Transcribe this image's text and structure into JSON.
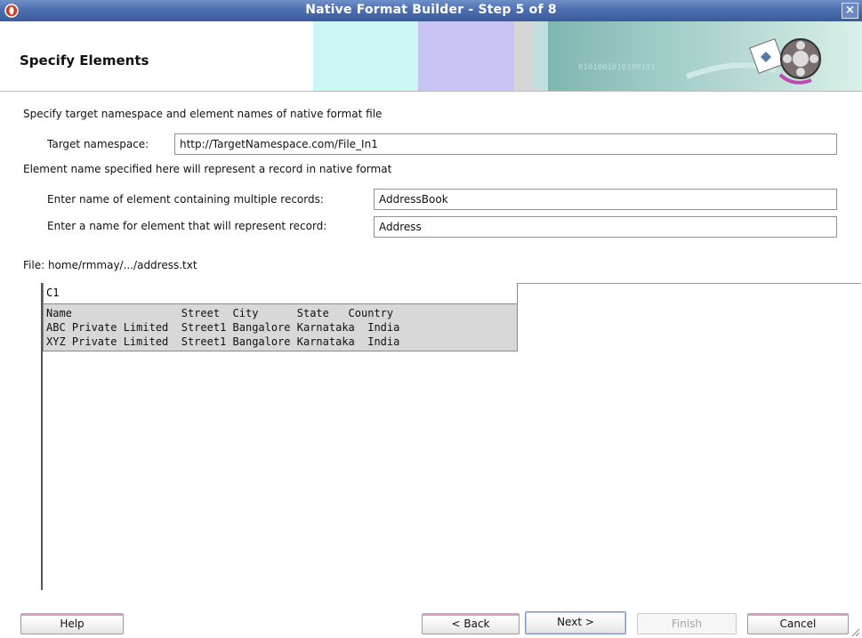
{
  "window": {
    "title": "Native Format Builder - Step 5 of 8",
    "close_label": "×"
  },
  "header": {
    "title": "Specify Elements"
  },
  "instructions": {
    "intro": "Specify target namespace and element names of native format file",
    "element_note": "Element name specified here will represent a record in native format"
  },
  "form": {
    "namespace_label": "Target namespace:",
    "namespace_value": "http://TargetNamespace.com/File_In1",
    "container_label": "Enter name of element containing multiple records:",
    "container_value": "AddressBook",
    "record_label": "Enter a name for element that will represent record:",
    "record_value": "Address"
  },
  "file": {
    "path_text": "File: home/rmmay/.../address.txt"
  },
  "preview": {
    "column_header": "C1",
    "rows": [
      "Name                 Street  City      State   Country",
      "ABC Private Limited  Street1 Bangalore Karnataka  India",
      "XYZ Private Limited  Street1 Bangalore Karnataka  India"
    ]
  },
  "buttons": {
    "help": "Help",
    "back": "< Back",
    "next": "Next >",
    "finish": "Finish",
    "cancel": "Cancel"
  },
  "colors": {
    "titlebar": "#4d6fb0",
    "banner_cyan": "#ccf6f6",
    "banner_lavender": "#c8c4f4",
    "banner_teal": "#8cc6c4",
    "grid_body": "#d8d8d8"
  }
}
